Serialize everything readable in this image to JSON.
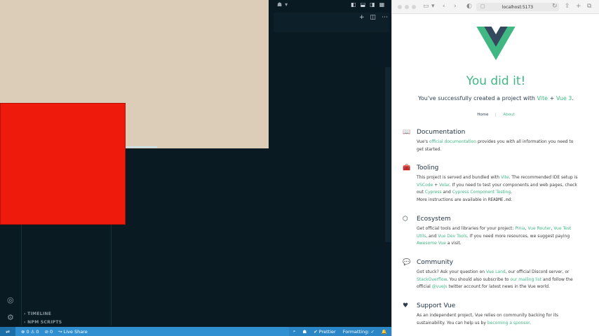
{
  "vscode": {
    "sidebar": {
      "timeline": "TIMELINE",
      "npm_scripts": "NPM SCRIPTS"
    },
    "statusbar": {
      "errors": "0",
      "warnings": "0",
      "ports": "0",
      "live_share": "Live Share",
      "prettier": "Prettier",
      "formatting": "Formatting: ✓"
    }
  },
  "browser": {
    "url": "localhost:5173",
    "hero": {
      "title": "You did it!",
      "sub_prefix": "You've successfully created a project with",
      "vite": "Vite",
      "plus": "+",
      "vue3": "Vue 3",
      "period": "."
    },
    "nav": {
      "home": "Home",
      "about": "About"
    },
    "sections": {
      "documentation": {
        "title": "Documentation",
        "p1": "Vue's",
        "link1": "official documentation",
        "p2": "provides you with all information you need to get started."
      },
      "tooling": {
        "title": "Tooling",
        "p1": "This project is served and bundled with",
        "link_vite": "Vite",
        "p2": ". The recommended IDE setup is",
        "link_vscode": "VSCode",
        "plus": "+",
        "link_volar": "Volar",
        "p3": ". If you need to test your components and web pages, check out",
        "link_cypress": "Cypress",
        "and": "and",
        "link_cct": "Cypress Component Testing",
        "dot": ".",
        "p4": "More instructions are available in",
        "readme": "README.md",
        "dot2": "."
      },
      "ecosystem": {
        "title": "Ecosystem",
        "p1": "Get official tools and libraries for your project:",
        "link_pinia": "Pinia",
        "comma1": ",",
        "link_router": "Vue Router",
        "comma2": ",",
        "link_test_utils": "Vue Test Utils",
        "and": ", and",
        "link_devtools": "Vue Dev Tools",
        "p2": ". If you need more resources, we suggest paying",
        "link_awesome": "Awesome Vue",
        "p3": "a visit."
      },
      "community": {
        "title": "Community",
        "p1": "Got stuck? Ask your question on",
        "link_vueland": "Vue Land",
        "p2": ", our official Discord server, or",
        "link_so": "StackOverflow",
        "p3": ". You should also subscribe to",
        "link_mailing": "our mailing list",
        "p4": "and follow the official",
        "link_twitter": "@vuejs",
        "p5": "twitter account for latest news in the Vue world."
      },
      "support": {
        "title": "Support Vue",
        "p1": "As an independent project, Vue relies on community backing for its sustainability. You can help us by",
        "link_sponsor": "becoming a sponsor",
        "p2": "."
      }
    }
  },
  "colors": {
    "vue_green": "#41b883",
    "vue_dark": "#35495e",
    "status_blue": "#2f8fd0",
    "red_block": "#ee1b0c",
    "beige_block": "#dccdb9"
  }
}
